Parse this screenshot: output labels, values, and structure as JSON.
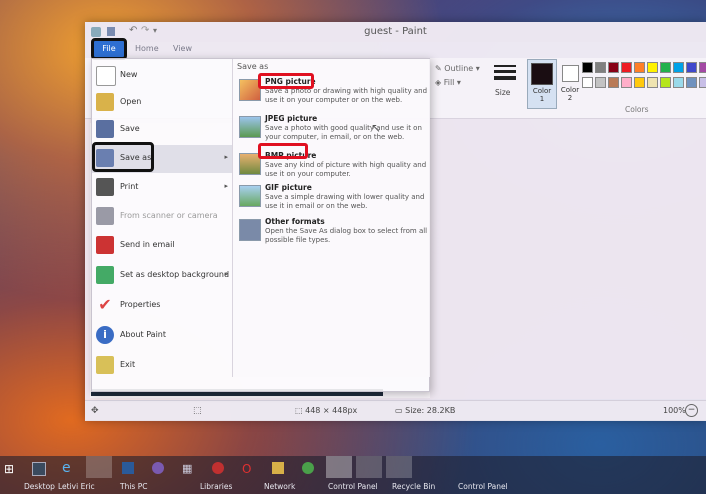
{
  "window": {
    "title": "guest - Paint",
    "tabs": [
      "File",
      "Home",
      "View"
    ]
  },
  "ribbon": {
    "outline_label": "Outline",
    "fill_label": "Fill",
    "size_label": "Size",
    "color1_label": "Color 1",
    "color2_label": "Color 2",
    "colors_group_label": "Colors",
    "palette": [
      "#000000",
      "#7f7f7f",
      "#880015",
      "#ed1c24",
      "#ff7f27",
      "#fff200",
      "#22b14c",
      "#00a2e8",
      "#3f48cc",
      "#a349a4",
      "#ffffff",
      "#c3c3c3",
      "#b97a57",
      "#ffaec9",
      "#ffc90e",
      "#efe4b0",
      "#b5e61d",
      "#99d9ea",
      "#7092be",
      "#c8bfe7"
    ]
  },
  "file_menu": {
    "items": [
      {
        "label": "New"
      },
      {
        "label": "Open"
      },
      {
        "label": "Save"
      },
      {
        "label": "Save as"
      },
      {
        "label": "Print"
      },
      {
        "label": "From scanner or camera"
      },
      {
        "label": "Send in email"
      },
      {
        "label": "Set as desktop background"
      },
      {
        "label": "Properties"
      },
      {
        "label": "About Paint"
      },
      {
        "label": "Exit"
      }
    ],
    "save_as_panel": {
      "title": "Save as",
      "options": [
        {
          "title": "PNG picture",
          "desc": "Save a photo or drawing with high quality and use it on your computer or on the web."
        },
        {
          "title": "JPEG picture",
          "desc": "Save a photo with good quality and use it on your computer, in email, or on the web."
        },
        {
          "title": "BMP picture",
          "desc": "Save any kind of picture with high quality and use it on your computer."
        },
        {
          "title": "GIF picture",
          "desc": "Save a simple drawing with lower quality and use it in email or on the web."
        },
        {
          "title": "Other formats",
          "desc": "Open the Save As dialog box to select from all possible file types."
        }
      ]
    }
  },
  "status": {
    "dimensions": "448 × 448px",
    "size": "Size: 28.2KB",
    "zoom": "100%"
  },
  "taskbar": {
    "labels": [
      "Desktop",
      "Letivi Eric",
      "This PC",
      "Libraries",
      "Network",
      "Control Panel",
      "Recycle Bin",
      "Control Panel"
    ]
  }
}
